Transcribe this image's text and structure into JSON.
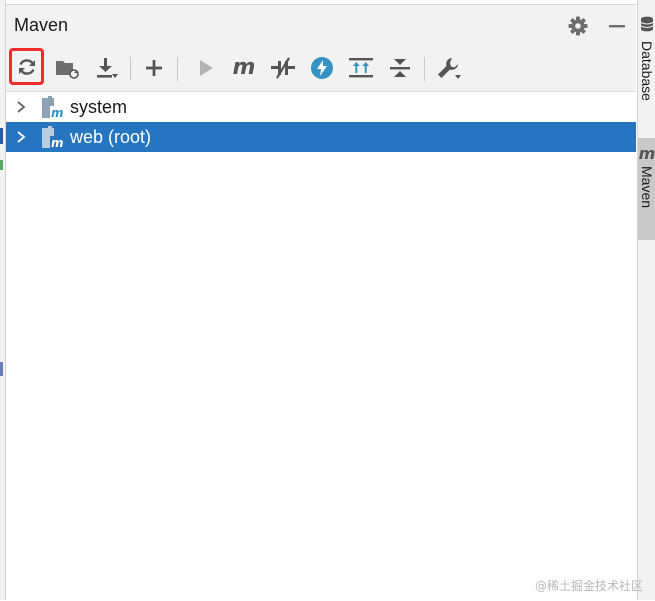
{
  "panel": {
    "title": "Maven"
  },
  "header_icons": [
    "gear-icon",
    "minimize-icon"
  ],
  "toolbar": {
    "buttons": [
      {
        "name": "reload-all-maven-projects-button",
        "icon": "refresh-icon"
      },
      {
        "name": "generate-sources-button",
        "icon": "folder-refresh-icon"
      },
      {
        "name": "download-sources-button",
        "icon": "download-icon"
      },
      {
        "name": "add-maven-project-button",
        "icon": "plus-icon"
      },
      {
        "name": "run-maven-build-button",
        "icon": "run-icon"
      },
      {
        "name": "execute-maven-goal-button",
        "icon": "maven-m-icon",
        "glyph": "m"
      },
      {
        "name": "toggle-offline-mode-button",
        "icon": "offline-icon"
      },
      {
        "name": "skip-tests-button",
        "icon": "lightning-icon"
      },
      {
        "name": "show-dependencies-button",
        "icon": "dependencies-icon"
      },
      {
        "name": "collapse-all-button",
        "icon": "collapse-icon"
      },
      {
        "name": "maven-settings-button",
        "icon": "wrench-icon"
      }
    ]
  },
  "tree": {
    "items": [
      {
        "label": "system",
        "selected": false
      },
      {
        "label": "web (root)",
        "selected": true
      }
    ]
  },
  "side_tabs": [
    {
      "label": "Database",
      "icon": "database-icon",
      "active": false
    },
    {
      "label": "Maven",
      "icon": "maven-m-icon",
      "glyph": "m",
      "active": true
    }
  ],
  "watermark": "@稀土掘金技术社区",
  "colors": {
    "selection": "#2675c0",
    "highlight_border": "#ef2b2b",
    "toolbar_bg": "#f2f2f2",
    "accent_blue": "#3592c4"
  }
}
